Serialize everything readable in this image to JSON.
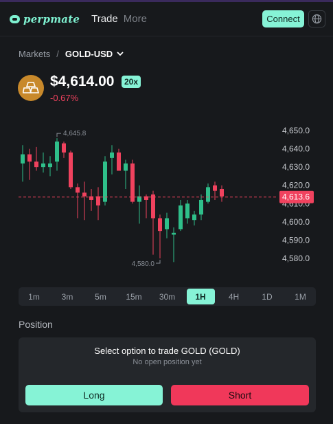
{
  "header": {
    "logo_text": "perpmate",
    "nav": {
      "trade": "Trade",
      "more": "More"
    },
    "connect_label": "Connect",
    "globe_icon": "globe-icon"
  },
  "breadcrumb": {
    "markets": "Markets",
    "separator": "/",
    "symbol": "GOLD-USD"
  },
  "asset": {
    "icon": "gold-bars-icon",
    "price": "$4,614.00",
    "leverage": "20x",
    "change": "-0.67%"
  },
  "colors": {
    "up": "#2fbf8a",
    "down": "#f0425e",
    "accent": "#86f3d6",
    "current_price_line": "#f0425e"
  },
  "chart_data": {
    "type": "candlestick",
    "y_ticks": [
      "4,650.0",
      "4,640.0",
      "4,630.0",
      "4,620.0",
      "4,610.0",
      "4,600.0",
      "4,590.0",
      "4,580.0"
    ],
    "y_tick_values": [
      4650,
      4640,
      4630,
      4620,
      4610,
      4600,
      4590,
      4580
    ],
    "ylim": [
      4575,
      4655
    ],
    "current_price": 4613.6,
    "current_price_label": "4,613.6",
    "high_label": "4,645.8",
    "high_value": 4645.8,
    "low_label": "4,580.0",
    "low_value": 4580.0,
    "high_candle_index": 5,
    "low_candle_index": 20,
    "candles": [
      {
        "o": 4632,
        "h": 4642,
        "l": 4622,
        "c": 4637
      },
      {
        "o": 4637,
        "h": 4640,
        "l": 4623,
        "c": 4633
      },
      {
        "o": 4633,
        "h": 4641,
        "l": 4628,
        "c": 4630
      },
      {
        "o": 4630,
        "h": 4638,
        "l": 4627,
        "c": 4632
      },
      {
        "o": 4630,
        "h": 4636,
        "l": 4625,
        "c": 4632
      },
      {
        "o": 4633,
        "h": 4645.8,
        "l": 4628,
        "c": 4644
      },
      {
        "o": 4643,
        "h": 4644,
        "l": 4635,
        "c": 4638
      },
      {
        "o": 4638,
        "h": 4639,
        "l": 4618,
        "c": 4619
      },
      {
        "o": 4619,
        "h": 4621,
        "l": 4602,
        "c": 4616
      },
      {
        "o": 4616,
        "h": 4622,
        "l": 4601,
        "c": 4614
      },
      {
        "o": 4614,
        "h": 4618,
        "l": 4606,
        "c": 4612
      },
      {
        "o": 4614,
        "h": 4619,
        "l": 4601,
        "c": 4609
      },
      {
        "o": 4611,
        "h": 4636,
        "l": 4609,
        "c": 4633
      },
      {
        "o": 4635,
        "h": 4642,
        "l": 4626,
        "c": 4638
      },
      {
        "o": 4638,
        "h": 4640,
        "l": 4628,
        "c": 4628
      },
      {
        "o": 4628,
        "h": 4634,
        "l": 4618,
        "c": 4632
      },
      {
        "o": 4632,
        "h": 4634,
        "l": 4610,
        "c": 4611
      },
      {
        "o": 4611,
        "h": 4620,
        "l": 4599,
        "c": 4614
      },
      {
        "o": 4614,
        "h": 4615,
        "l": 4602,
        "c": 4612
      },
      {
        "o": 4615,
        "h": 4617,
        "l": 4582,
        "c": 4602
      },
      {
        "o": 4602,
        "h": 4604,
        "l": 4580.0,
        "c": 4595
      },
      {
        "o": 4596,
        "h": 4605,
        "l": 4591,
        "c": 4602
      },
      {
        "o": 4593,
        "h": 4597,
        "l": 4578,
        "c": 4594
      },
      {
        "o": 4596,
        "h": 4612,
        "l": 4595,
        "c": 4609
      },
      {
        "o": 4602,
        "h": 4612,
        "l": 4599,
        "c": 4610
      },
      {
        "o": 4601,
        "h": 4606,
        "l": 4598,
        "c": 4604
      },
      {
        "o": 4604,
        "h": 4615,
        "l": 4601,
        "c": 4612
      },
      {
        "o": 4611,
        "h": 4621,
        "l": 4610,
        "c": 4619
      },
      {
        "o": 4620,
        "h": 4622,
        "l": 4612,
        "c": 4617
      },
      {
        "o": 4618,
        "h": 4620,
        "l": 4611,
        "c": 4614
      }
    ]
  },
  "timeframes": {
    "items": [
      "1m",
      "3m",
      "5m",
      "15m",
      "30m",
      "1H",
      "4H",
      "1D",
      "1M"
    ],
    "active": "1H"
  },
  "position": {
    "title": "Position",
    "card_title": "Select option to trade GOLD (GOLD)",
    "card_subtitle": "No open position yet",
    "long_label": "Long",
    "short_label": "Short"
  }
}
